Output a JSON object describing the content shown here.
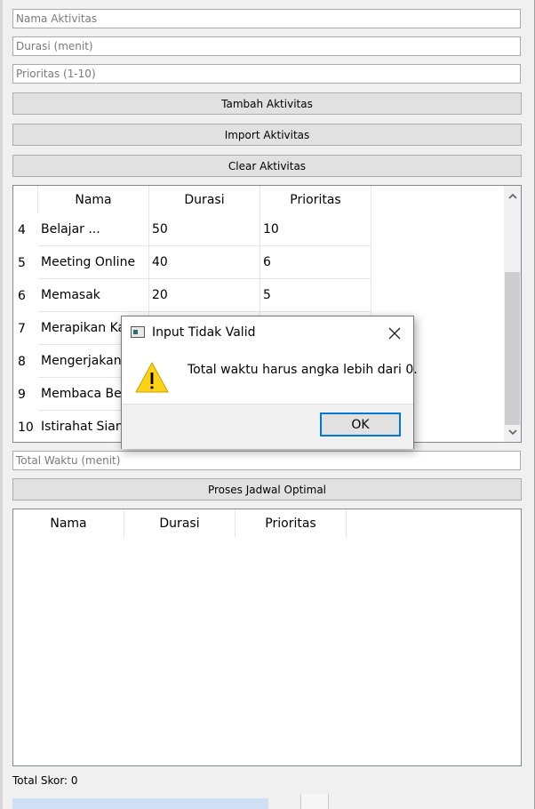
{
  "inputs": {
    "nama_placeholder": "Nama Aktivitas",
    "durasi_placeholder": "Durasi (menit)",
    "prioritas_placeholder": "Prioritas (1-10)",
    "total_waktu_placeholder": "Total Waktu (menit)"
  },
  "buttons": {
    "tambah": "Tambah Aktivitas",
    "import": "Import Aktivitas",
    "clear": "Clear Aktivitas",
    "proses": "Proses Jadwal Optimal"
  },
  "activity_table": {
    "headers": [
      "Nama",
      "Durasi",
      "Prioritas"
    ],
    "rows": [
      {
        "num": "4",
        "nama": "Belajar ...",
        "durasi": "50",
        "prioritas": "10"
      },
      {
        "num": "5",
        "nama": "Meeting Online",
        "durasi": "40",
        "prioritas": "6"
      },
      {
        "num": "6",
        "nama": "Memasak",
        "durasi": "20",
        "prioritas": "5"
      },
      {
        "num": "7",
        "nama": "Merapikan Ka",
        "durasi": "",
        "prioritas": ""
      },
      {
        "num": "8",
        "nama": "Mengerjakan",
        "durasi": "",
        "prioritas": ""
      },
      {
        "num": "9",
        "nama": "Membaca Ber",
        "durasi": "",
        "prioritas": ""
      },
      {
        "num": "10",
        "nama": "Istirahat Siang",
        "durasi": "",
        "prioritas": ""
      }
    ]
  },
  "result_table": {
    "headers": [
      "Nama",
      "Durasi",
      "Prioritas"
    ]
  },
  "total_skor": "Total Skor: 0",
  "dialog": {
    "title": "Input Tidak Valid",
    "message": "Total waktu harus angka lebih dari 0.",
    "ok_label": "OK",
    "icon": "warning-icon"
  },
  "colors": {
    "accent": "#0078d7",
    "warning_fill": "#fcd116"
  }
}
